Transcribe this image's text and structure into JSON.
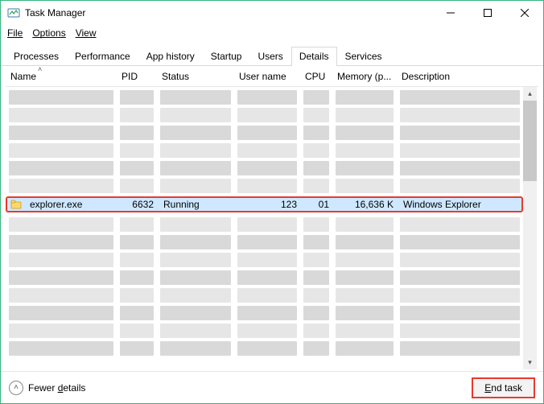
{
  "title": "Task Manager",
  "menus": {
    "file": "File",
    "options": "Options",
    "view": "View"
  },
  "tabs": [
    {
      "label": "Processes",
      "active": false
    },
    {
      "label": "Performance",
      "active": false
    },
    {
      "label": "App history",
      "active": false
    },
    {
      "label": "Startup",
      "active": false
    },
    {
      "label": "Users",
      "active": false
    },
    {
      "label": "Details",
      "active": true
    },
    {
      "label": "Services",
      "active": false
    }
  ],
  "columns": {
    "name": "Name",
    "pid": "PID",
    "status": "Status",
    "user": "User name",
    "cpu": "CPU",
    "memory": "Memory (p...",
    "description": "Description"
  },
  "highlighted_row": {
    "name": "explorer.exe",
    "pid": "6632",
    "status": "Running",
    "user": "123",
    "cpu": "01",
    "memory": "16,636 K",
    "description": "Windows Explorer"
  },
  "footer": {
    "fewer_details": "Fewer details",
    "end_task": "End task"
  }
}
